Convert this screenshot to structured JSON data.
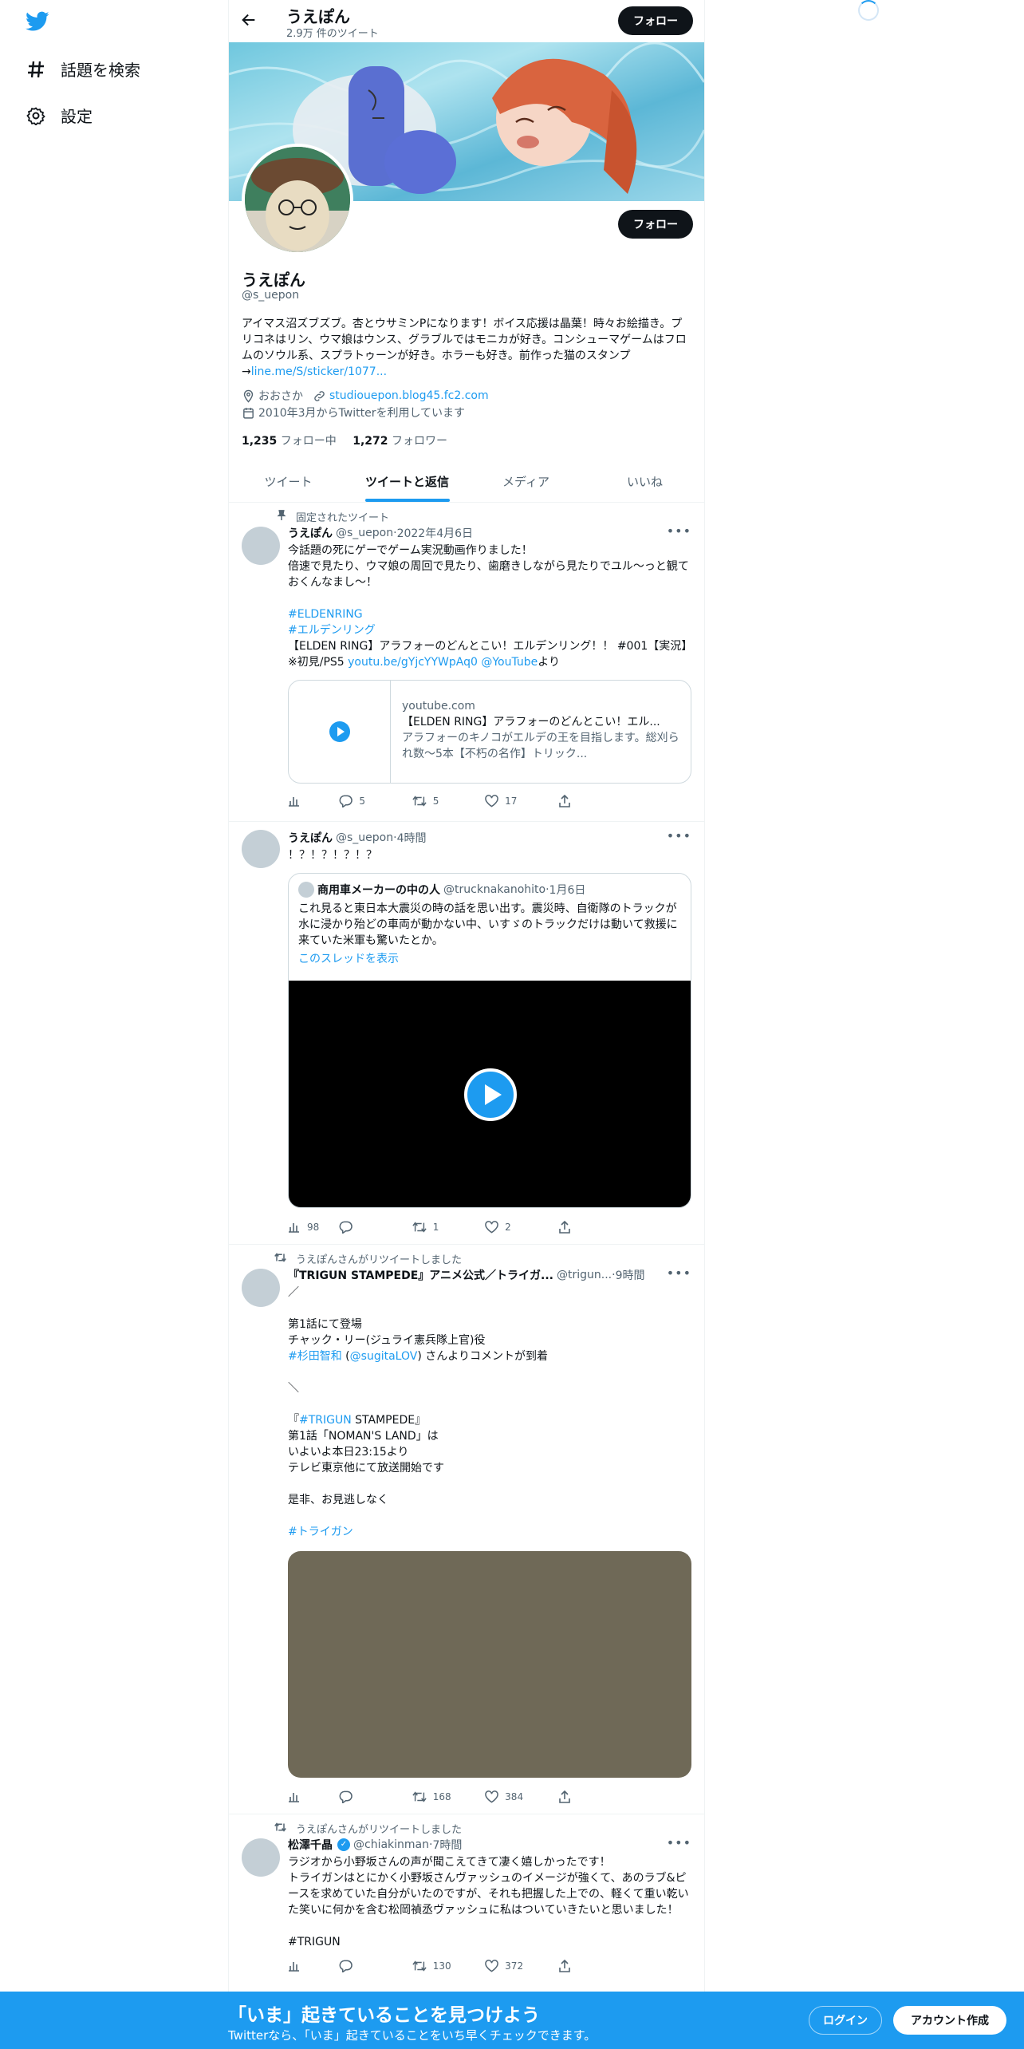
{
  "nav": {
    "explore_label": "話題を検索",
    "settings_label": "設定"
  },
  "header": {
    "name": "うえぽん",
    "tweet_count": "2.9万 件のツイート",
    "follow_label": "フォロー"
  },
  "profile": {
    "name": "うえぽん",
    "handle": "@s_uepon",
    "follow_label": "フォロー",
    "bio_text": "アイマス沼ズブズブ。杏とウサミンPになります！ボイス応援は晶葉！時々お絵描き。プリコネはリン、ウマ娘はウンス、グラブルではモニカが好き。コンシューマゲームはフロムのソウル系、スプラトゥーンが好き。ホラーも好き。前作った猫のスタンプ→",
    "bio_link": "line.me/S/sticker/1077...",
    "location": "おおさか",
    "website": "studiouepon.blog45.fc2.com",
    "joined": "2010年3月からTwitterを利用しています",
    "following_count": "1,235",
    "following_label": "フォロー中",
    "followers_count": "1,272",
    "followers_label": "フォロワー"
  },
  "tabs": [
    "ツイート",
    "ツイートと返信",
    "メディア",
    "いいね"
  ],
  "tweets": [
    {
      "social": "固定されたツイート",
      "name": "うえぽん",
      "handle": "@s_uepon",
      "time": "2022年4月6日",
      "text1": "今話題の死にゲーでゲーム実況動画作りました！",
      "text2": "倍速で見たり、ウマ娘の周回で見たり、歯磨きしながら見たりでユル～っと観ておくんなまし～！",
      "tag1": "#ELDENRING",
      "tag2": "#エルデンリング",
      "text3": "【ELDEN RING】アラフォーのどんとこい！エルデンリング！！ #001【実況】※初見/PS5 ",
      "link": "youtu.be/gYjcYYWpAq0",
      "mention": "@YouTube",
      "text4": "より",
      "card": {
        "domain": "youtube.com",
        "title": "【ELDEN RING】アラフォーのどんとこい！エル...",
        "desc": "アラフォーのキノコがエルデの王を目指します。総刈られ数～5本【不朽の名作】トリック..."
      },
      "replies": "5",
      "retweets": "5",
      "likes": "17"
    },
    {
      "name": "うえぽん",
      "handle": "@s_uepon",
      "time": "4時間",
      "text": "！？！？！？！？",
      "quote": {
        "name": "商用車メーカーの中の人",
        "handle": "@trucknakanohito",
        "time": "1月6日",
        "text": "これ見ると東日本大震災の時の話を思い出す。震災時、自衛隊のトラックが水に浸かり殆どの車両が動かない中、いすゞのトラックだけは動いて救援に来ていた米軍も驚いたとか。",
        "thread": "このスレッドを表示"
      },
      "views": "98",
      "retweets": "1",
      "likes": "2"
    },
    {
      "social": "うえぽんさんがリツイートしました",
      "name": "『TRIGUN STAMPEDE』アニメ公式／トライガ...",
      "handle": "@trigun...",
      "time": "9時間",
      "l1": "／",
      "l2": "第1話にて登場",
      "l3": "チャック・リー(ジュライ憲兵隊上官)役",
      "tag": "#杉田智和",
      "mention": "@sugitaLOV",
      "l4": "さんよりコメントが到着",
      "l5": "＼",
      "l6a": "『",
      "tag2": "#TRIGUN",
      "l6b": " STAMPEDE』",
      "l7": "第1話「NOMAN'S LAND」は",
      "l8": "いよいよ本日23:15より",
      "l9": "テレビ東京他にて放送開始です",
      "l10": "是非、お見逃しなく",
      "tag3": "#トライガン",
      "retweets": "168",
      "likes": "384"
    },
    {
      "social": "うえぽんさんがリツイートしました",
      "name": "松澤千晶",
      "handle": "@chiakinman",
      "time": "7時間",
      "text": "ラジオから小野坂さんの声が聞こえてきて凄く嬉しかったです！\nトライガンはとにかく小野坂さんヴァッシュのイメージが強くて、あのラブ&ピースを求めていた自分がいたのですが、それも把握した上での、軽くて重い乾いた笑いに何かを含む松岡禎丞ヴァッシュに私はついていきたいと思いました！",
      "tag": "#TRIGUN",
      "retweets": "130",
      "likes": "372"
    }
  ],
  "bottom": {
    "title": "「いま」起きていることを見つけよう",
    "subtitle": "Twitterなら、「いま」起きていることをいち早くチェックできます。",
    "login": "ログイン",
    "signup": "アカウント作成"
  },
  "colors": {
    "accent": "#1d9bf0",
    "text": "#0f1419",
    "muted": "#536471",
    "media_placeholder": "#6f6957"
  }
}
